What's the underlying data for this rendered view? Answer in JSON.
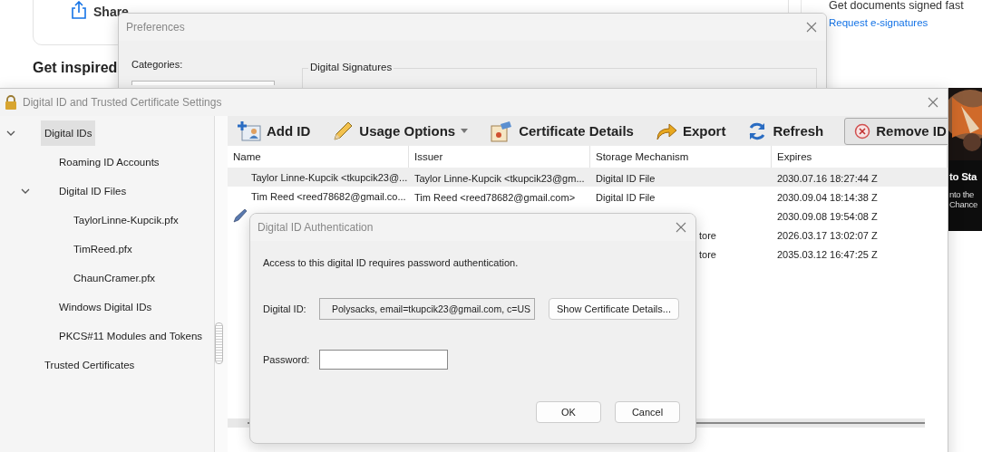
{
  "background_page": {
    "share_label": "Share",
    "section_title": "Get inspired",
    "sign_panel": {
      "heading": "Get documents signed fast",
      "link": "Request e-signatures"
    },
    "promo_card": {
      "kind": "picture",
      "lines": [
        "to Sta",
        "nto the",
        "Chance"
      ]
    }
  },
  "preferences_dialog": {
    "title": "Preferences",
    "categories_label": "Categories:",
    "group_title": "Digital Signatures"
  },
  "settings_window": {
    "title": "Digital ID and Trusted Certificate Settings",
    "tree": [
      {
        "label": "Digital IDs",
        "selected": true,
        "expanded": true,
        "children": [
          {
            "label": "Roaming ID Accounts",
            "selected": false
          },
          {
            "label": "Digital ID Files",
            "selected": false,
            "expanded": true,
            "children": [
              {
                "label": "TaylorLinne-Kupcik.pfx",
                "selected": false
              },
              {
                "label": "TimReed.pfx",
                "selected": false
              },
              {
                "label": "ChaunCramer.pfx",
                "selected": false
              }
            ]
          },
          {
            "label": "Windows Digital IDs",
            "selected": false
          },
          {
            "label": "PKCS#11 Modules and Tokens",
            "selected": false
          }
        ]
      },
      {
        "label": "Trusted Certificates",
        "selected": false
      }
    ],
    "toolbar": [
      {
        "label": "Add ID",
        "kind": "add",
        "pressed": false
      },
      {
        "label": "Usage Options",
        "kind": "usage",
        "pressed": false
      },
      {
        "label": "Certificate Details",
        "kind": "certificate",
        "pressed": false
      },
      {
        "label": "Export",
        "kind": "export",
        "pressed": false
      },
      {
        "label": "Refresh",
        "kind": "refresh",
        "pressed": false
      },
      {
        "label": "Remove ID",
        "kind": "remove",
        "pressed": true
      }
    ],
    "table": {
      "columns": [
        "Name",
        "Issuer",
        "Storage Mechanism",
        "Expires"
      ],
      "rows": [
        {
          "selected": true,
          "default_signer": false,
          "name": "Taylor Linne-Kupcik <tkupcik23@...",
          "issuer": "Taylor Linne-Kupcik <tkupcik23@gm...",
          "storage": "Digital ID File",
          "expires": "2030.07.16 18:27:44 Z"
        },
        {
          "selected": false,
          "default_signer": false,
          "name": "Tim Reed <reed78682@gmail.co...",
          "issuer": "Tim Reed <reed78682@gmail.com>",
          "storage": "Digital ID File",
          "expires": "2030.09.04 18:14:38 Z"
        },
        {
          "selected": false,
          "default_signer": true,
          "expires": "2030.09.08 19:54:08 Z"
        },
        {
          "selected": false,
          "default_signer": false,
          "storage": "tore",
          "expires": "2026.03.17 13:02:07 Z"
        },
        {
          "selected": false,
          "default_signer": false,
          "storage": "tore",
          "expires": "2035.03.12 16:47:25 Z"
        }
      ]
    }
  },
  "auth_dialog": {
    "title": "Digital ID Authentication",
    "message": "Access to this digital ID requires password authentication.",
    "digital_id_label": "Digital ID:",
    "digital_id_value": "Polysacks, email=tkupcik23@gmail.com, c=US",
    "details_button": "Show Certificate Details...",
    "password_label": "Password:",
    "buttons": [
      "OK",
      "Cancel"
    ]
  }
}
